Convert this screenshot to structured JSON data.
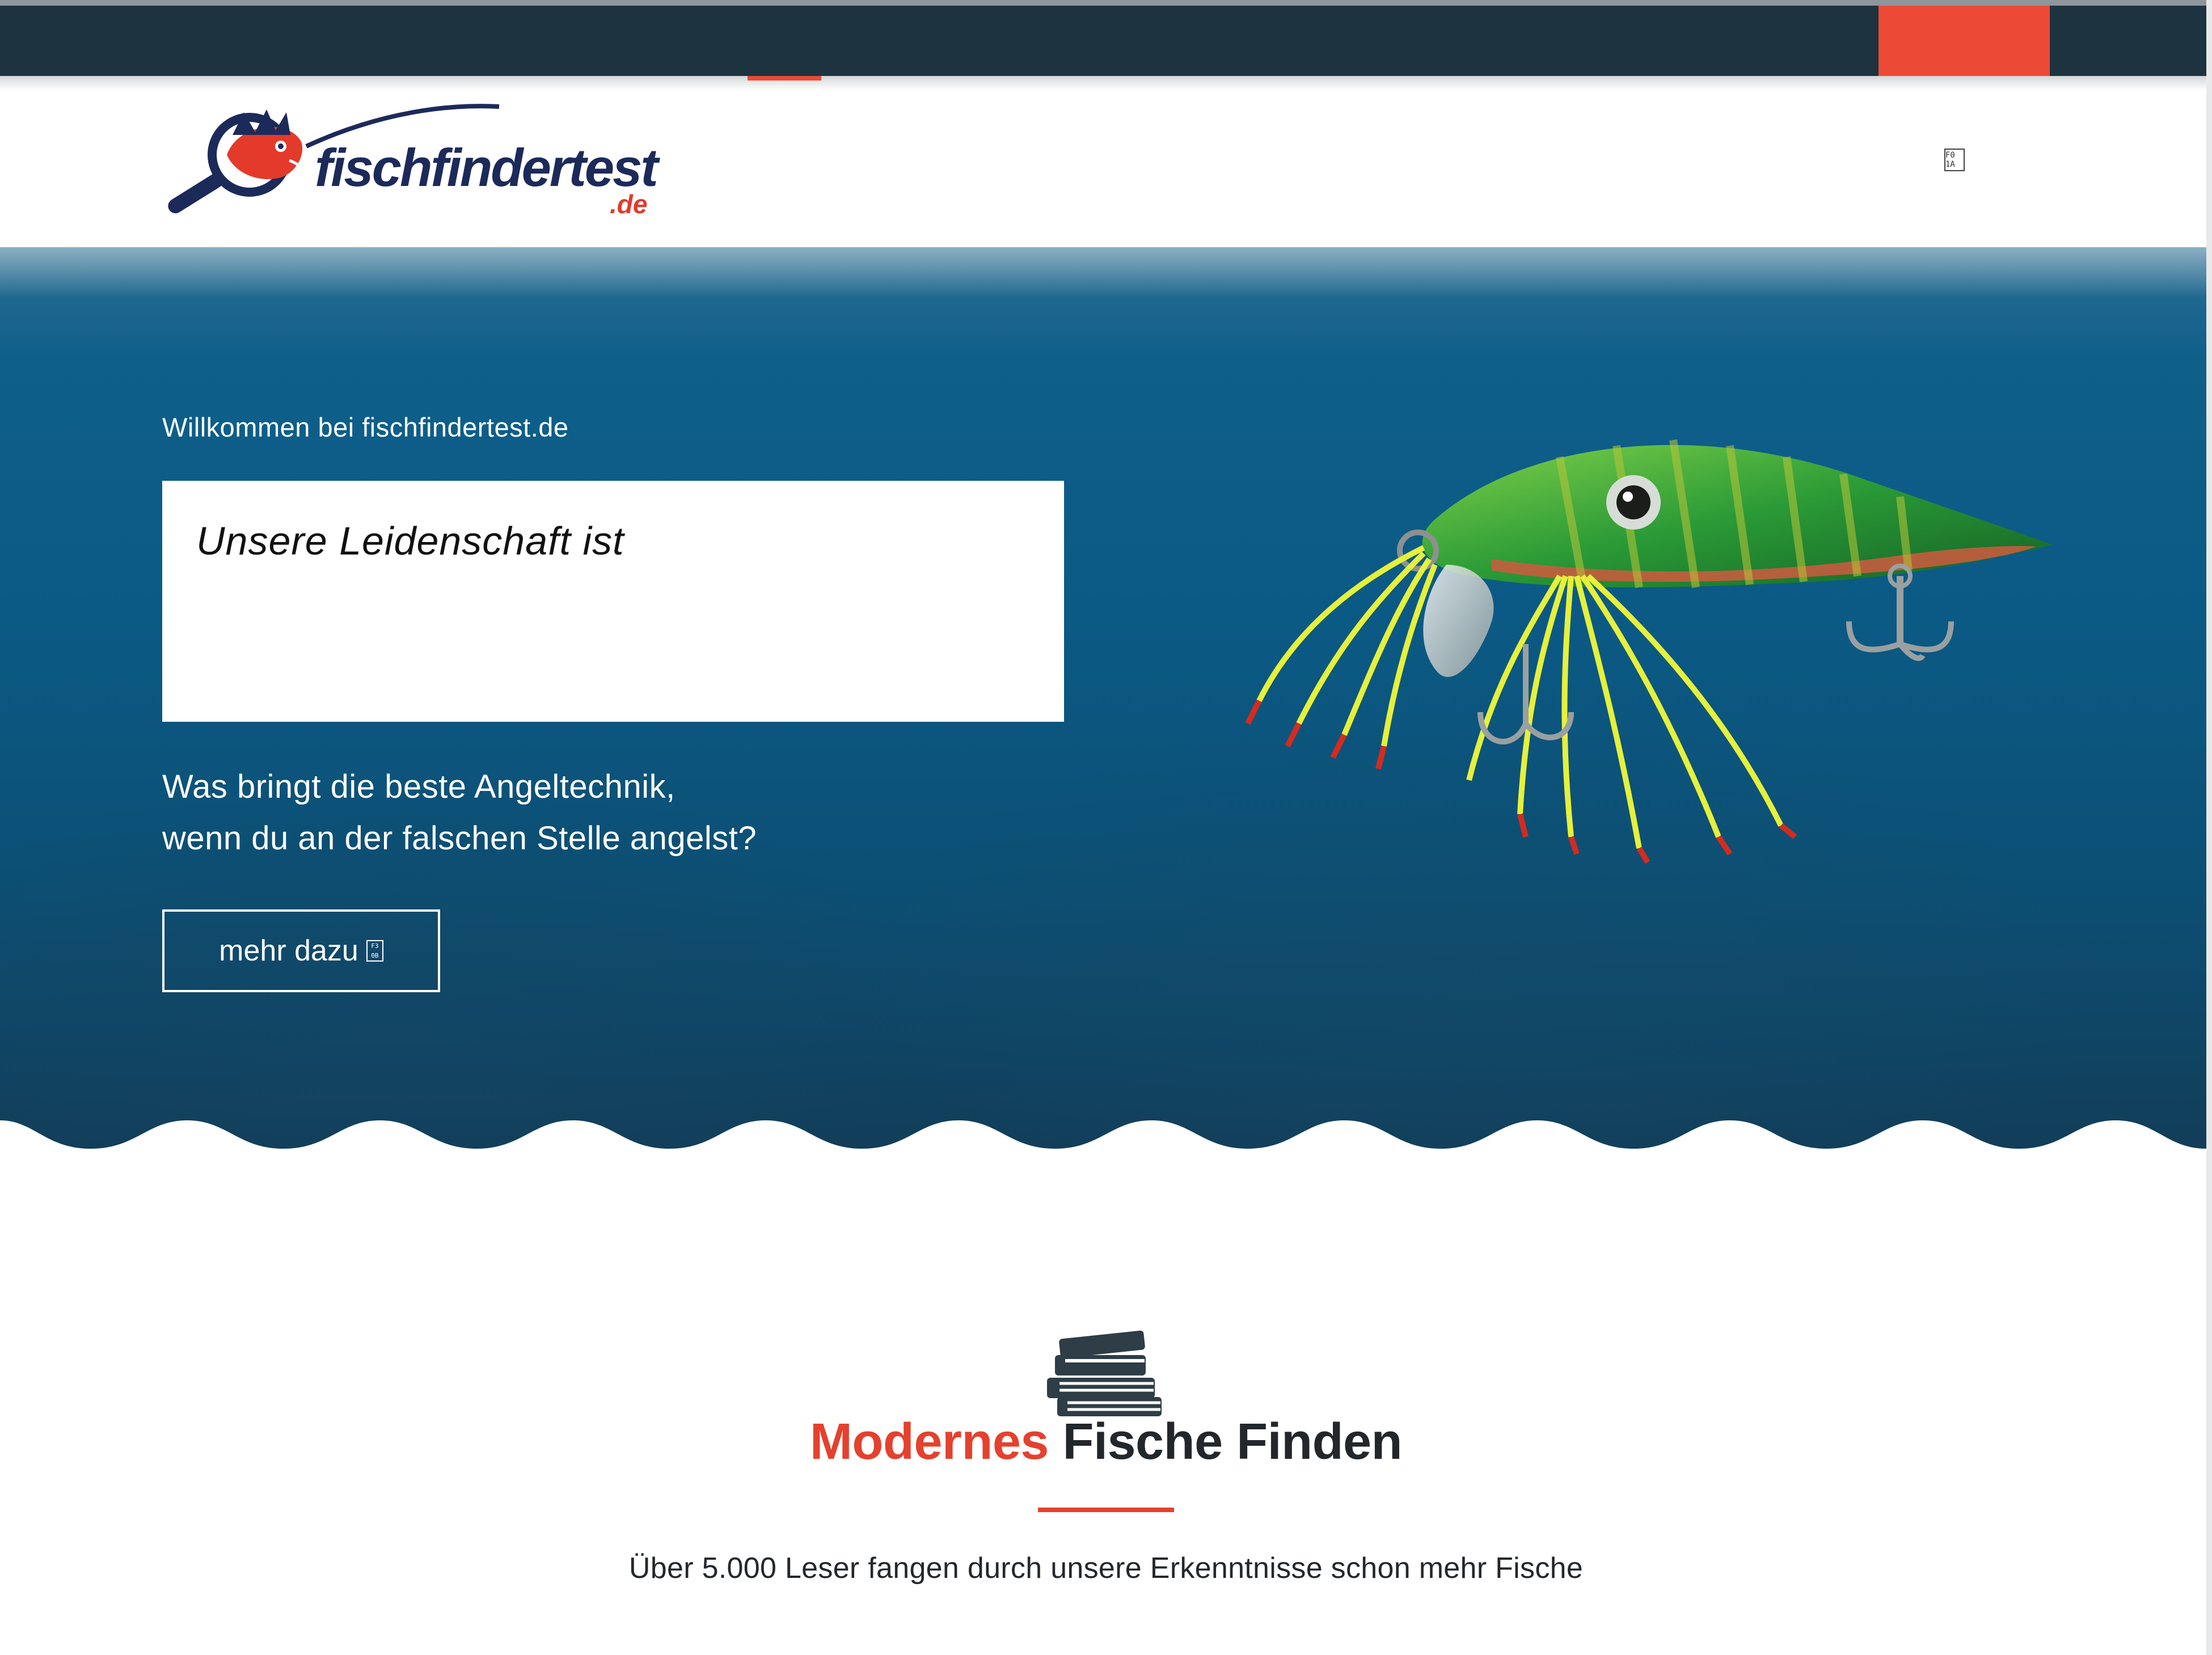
{
  "colors": {
    "topbar": "#1e3340",
    "accent": "#ec4a36",
    "hero_blue": "#0b5a85",
    "text_dark": "#22272b"
  },
  "header": {
    "logo_text": "fischfindertest",
    "logo_tld": ".de",
    "menu_icon": "menu-icon",
    "menu_icon_glyph": "F0\n1A"
  },
  "hero": {
    "welcome": "Willkommen bei fischfindertest.de",
    "passion": "Unsere Leidenschaft ist",
    "question_line1": "Was bringt die beste Angeltechnik,",
    "question_line2": "wenn du an der falschen Stelle angelst?",
    "button_label": "mehr dazu",
    "button_icon_glyph": "F3\n0B"
  },
  "features": {
    "icon": "books-icon",
    "title_highlight": "Modernes",
    "title_rest": " Fische Finden",
    "subtitle": "Über 5.000 Leser fangen durch unsere Erkenntnisse schon mehr Fische"
  }
}
